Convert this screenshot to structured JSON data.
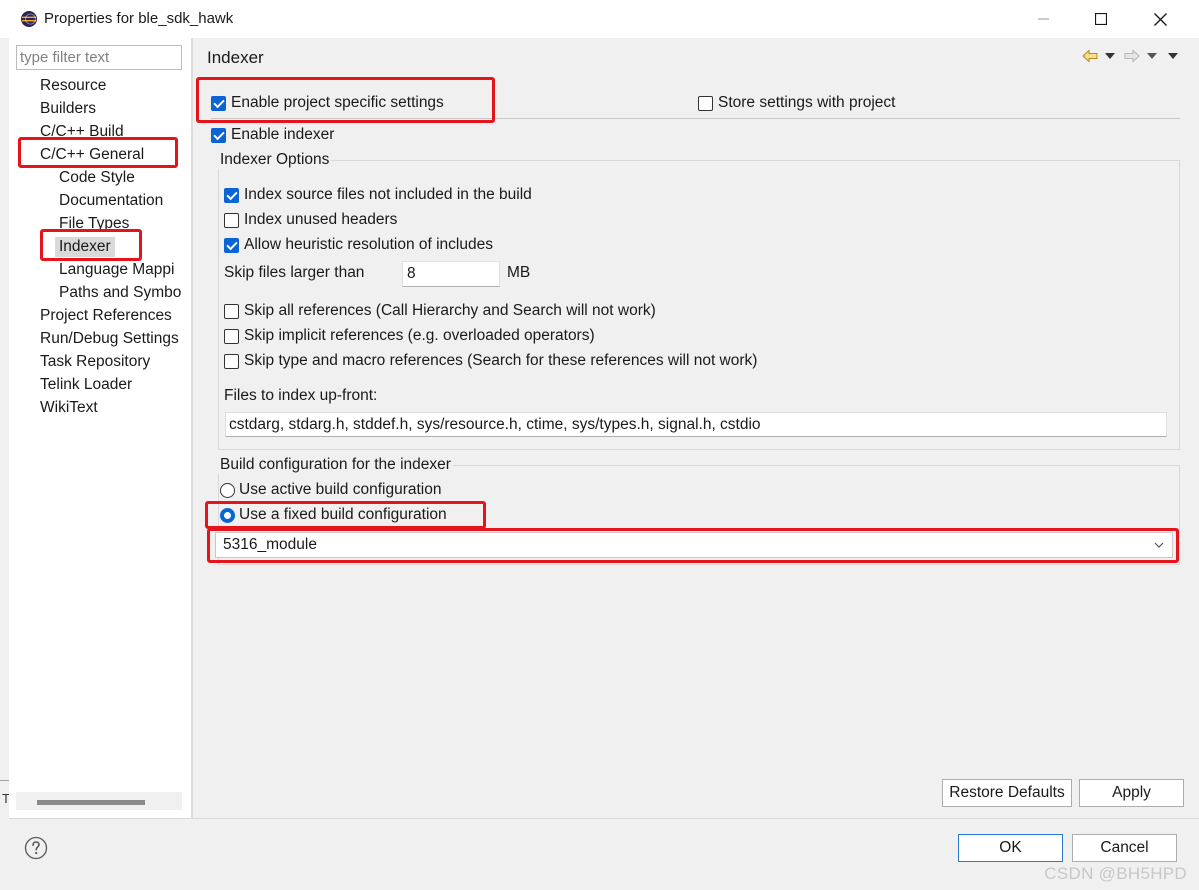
{
  "window": {
    "title": "Properties for ble_sdk_hawk",
    "app_icon": "eclipse-icon",
    "controls": [
      "minimize-icon",
      "maximize-icon",
      "close-icon"
    ]
  },
  "left_strip": {
    "text": "T"
  },
  "nav": {
    "filter_placeholder": "type filter text",
    "items": [
      {
        "label": "Resource",
        "level": 0
      },
      {
        "label": "Builders",
        "level": 0
      },
      {
        "label": "C/C++ Build",
        "level": 0
      },
      {
        "label": "C/C++ General",
        "level": 0
      },
      {
        "label": "Code Style",
        "level": 1
      },
      {
        "label": "Documentation",
        "level": 1
      },
      {
        "label": "File Types",
        "level": 1
      },
      {
        "label": "Indexer",
        "level": 1,
        "selected": true
      },
      {
        "label": "Language Mappi",
        "level": 1
      },
      {
        "label": "Paths and Symbo",
        "level": 1
      },
      {
        "label": "Project References",
        "level": 0
      },
      {
        "label": "Run/Debug Settings",
        "level": 0
      },
      {
        "label": "Task Repository",
        "level": 0
      },
      {
        "label": "Telink Loader",
        "level": 0
      },
      {
        "label": "WikiText",
        "level": 0
      }
    ]
  },
  "page": {
    "title": "Indexer",
    "toolbar_icons": [
      "back-arrow-icon",
      "back-menu-icon",
      "forward-arrow-icon",
      "forward-menu-icon",
      "view-menu-icon"
    ],
    "enable_project_specific": {
      "label": "Enable project specific settings",
      "checked": true
    },
    "store_with_project": {
      "label": "Store settings with project",
      "checked": false
    },
    "enable_indexer": {
      "label": "Enable indexer",
      "checked": true
    },
    "indexer_options": {
      "title": "Indexer Options",
      "index_source_not_in_build": {
        "label": "Index source files not included in the build",
        "checked": true
      },
      "index_unused_headers": {
        "label": "Index unused headers",
        "checked": false
      },
      "allow_heuristic": {
        "label": "Allow heuristic resolution of includes",
        "checked": true
      },
      "skip_files_label": "Skip files larger than",
      "skip_files_value": "8",
      "skip_files_unit": "MB",
      "skip_all_refs": {
        "label": "Skip all references (Call Hierarchy and Search will not work)",
        "checked": false
      },
      "skip_implicit_refs": {
        "label": "Skip implicit references (e.g. overloaded operators)",
        "checked": false
      },
      "skip_type_macro_refs": {
        "label": "Skip type and macro references (Search for these references will not work)",
        "checked": false
      },
      "upfront_label": "Files to index up-front:",
      "upfront_value": "cstdarg, stdarg.h, stddef.h, sys/resource.h, ctime, sys/types.h, signal.h, cstdio"
    },
    "build_config": {
      "title": "Build configuration for the indexer",
      "use_active": {
        "label": "Use active build configuration",
        "selected": false
      },
      "use_fixed": {
        "label": "Use a fixed build configuration",
        "selected": true
      },
      "selected_config": "5316_module"
    },
    "restore_defaults_label": "Restore Defaults",
    "apply_label": "Apply"
  },
  "footer": {
    "help_icon": "help-icon",
    "ok_label": "OK",
    "cancel_label": "Cancel"
  },
  "watermark": "CSDN @BH5HPD",
  "colors": {
    "accent": "#0a64d6",
    "highlight_box": "#e5141b",
    "selected_nav_bg": "#d9d9d9",
    "dialog_bg": "#f0f0f0"
  }
}
